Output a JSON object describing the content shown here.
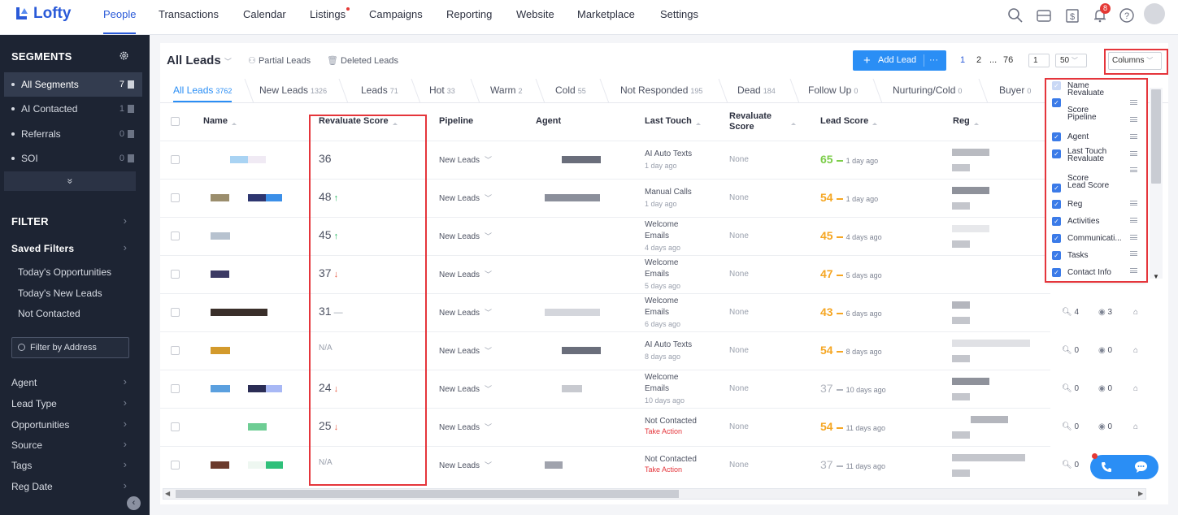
{
  "app": {
    "logo_text": "Lofty"
  },
  "nav": {
    "items": [
      "People",
      "Transactions",
      "Calendar",
      "Listings",
      "Campaigns",
      "Reporting",
      "Website",
      "Marketplace",
      "Settings"
    ],
    "active": "People",
    "notification_count": "8"
  },
  "sidebar": {
    "segments_title": "SEGMENTS",
    "segments": [
      {
        "label": "All Segments",
        "count": "7"
      },
      {
        "label": "AI Contacted",
        "count": "1"
      },
      {
        "label": "Referrals",
        "count": "0"
      },
      {
        "label": "SOI",
        "count": "0"
      }
    ],
    "expand_glyph": "»",
    "filter_title": "FILTER",
    "saved_filters_title": "Saved Filters",
    "saved_filters": [
      "Today's Opportunities",
      "Today's New Leads",
      "Not Contacted"
    ],
    "address_placeholder": "Filter by Address",
    "filter_groups": [
      "Agent",
      "Lead Type",
      "Opportunities",
      "Source",
      "Tags",
      "Reg Date"
    ]
  },
  "toolbar": {
    "title": "All Leads",
    "partial_leads": "Partial Leads",
    "deleted_leads": "Deleted Leads",
    "add_lead": "Add Lead",
    "more": "···",
    "pages": [
      "1",
      "2",
      "...",
      "76"
    ],
    "page_input": "1",
    "per_page": "50",
    "columns_button": "Columns"
  },
  "tabs": [
    {
      "label": "All Leads",
      "count": "3762"
    },
    {
      "label": "New Leads",
      "count": "1326"
    },
    {
      "label": "Leads",
      "count": "71"
    },
    {
      "label": "Hot",
      "count": "33"
    },
    {
      "label": "Warm",
      "count": "2"
    },
    {
      "label": "Cold",
      "count": "55"
    },
    {
      "label": "Not Responded",
      "count": "195"
    },
    {
      "label": "Dead",
      "count": "184"
    },
    {
      "label": "Follow Up",
      "count": "0"
    },
    {
      "label": "Nurturing/Cold",
      "count": "0"
    },
    {
      "label": "Buyer",
      "count": "0"
    }
  ],
  "table": {
    "headers": {
      "name": "Name",
      "revaluate_score": "Revaluate Score",
      "pipeline": "Pipeline",
      "agent": "Agent",
      "last_touch": "Last Touch",
      "revaluate_score_2": "Revaluate Score",
      "lead_score": "Lead Score",
      "reg": "Reg"
    },
    "rows": [
      {
        "reval": "36",
        "trend": "",
        "pipeline": "New Leads",
        "lt1": "AI Auto Texts",
        "lt2": "",
        "lt3": "1 day ago",
        "take": "",
        "reval2": "None",
        "score": "65",
        "score_color": "#7ccd4a",
        "ago": "1 day ago",
        "acts": []
      },
      {
        "reval": "48",
        "trend": "up",
        "pipeline": "New Leads",
        "lt1": "Manual Calls",
        "lt2": "",
        "lt3": "1 day ago",
        "take": "",
        "reval2": "None",
        "score": "54",
        "score_color": "#f5a623",
        "ago": "1 day ago",
        "acts": []
      },
      {
        "reval": "45",
        "trend": "up",
        "pipeline": "New Leads",
        "lt1": "Welcome",
        "lt2": "Emails",
        "lt3": "4 days ago",
        "take": "",
        "reval2": "None",
        "score": "45",
        "score_color": "#f5a623",
        "ago": "4 days ago",
        "acts": []
      },
      {
        "reval": "37",
        "trend": "down",
        "pipeline": "New Leads",
        "lt1": "Welcome",
        "lt2": "Emails",
        "lt3": "5 days ago",
        "take": "",
        "reval2": "None",
        "score": "47",
        "score_color": "#f5a623",
        "ago": "5 days ago",
        "acts": []
      },
      {
        "reval": "31",
        "trend": "flat",
        "pipeline": "New Leads",
        "lt1": "Welcome",
        "lt2": "Emails",
        "lt3": "6 days ago",
        "take": "",
        "reval2": "None",
        "score": "43",
        "score_color": "#f5a623",
        "ago": "6 days ago",
        "acts": [
          "4",
          "3"
        ]
      },
      {
        "reval": "N/A",
        "trend": "",
        "pipeline": "New Leads",
        "lt1": "AI Auto Texts",
        "lt2": "",
        "lt3": "8 days ago",
        "take": "",
        "reval2": "None",
        "score": "54",
        "score_color": "#f5a623",
        "ago": "8 days ago",
        "acts": [
          "0",
          "0"
        ]
      },
      {
        "reval": "24",
        "trend": "down",
        "pipeline": "New Leads",
        "lt1": "Welcome",
        "lt2": "Emails",
        "lt3": "10 days ago",
        "take": "",
        "reval2": "None",
        "score": "37",
        "score_color": "#b0b4bd",
        "ago": "10 days ago",
        "acts": [
          "0",
          "0"
        ]
      },
      {
        "reval": "25",
        "trend": "down",
        "pipeline": "New Leads",
        "lt1": "Not Contacted",
        "lt2": "",
        "lt3": "",
        "take": "Take Action",
        "reval2": "None",
        "score": "54",
        "score_color": "#f5a623",
        "ago": "11 days ago",
        "acts": [
          "0",
          "0"
        ]
      },
      {
        "reval": "N/A",
        "trend": "",
        "pipeline": "New Leads",
        "lt1": "Not Contacted",
        "lt2": "",
        "lt3": "",
        "take": "Take Action",
        "reval2": "None",
        "score": "37",
        "score_color": "#b0b4bd",
        "ago": "11 days ago",
        "acts": [
          "0"
        ]
      }
    ]
  },
  "columns_panel": {
    "items": [
      {
        "line1": "Name",
        "line2": "Revaluate"
      },
      {
        "line1": "Score",
        "line2": "Pipeline"
      },
      {
        "line1": "Agent",
        "line2": ""
      },
      {
        "line1": "Last Touch",
        "line2": "Revaluate"
      },
      {
        "line1": "Score",
        "line2": "Lead Score"
      },
      {
        "line1": "Reg",
        "line2": ""
      },
      {
        "line1": "Activities",
        "line2": ""
      },
      {
        "line1": "Communicati...",
        "line2": ""
      },
      {
        "line1": "Tasks",
        "line2": ""
      },
      {
        "line1": "Contact Info",
        "line2": ""
      }
    ]
  }
}
